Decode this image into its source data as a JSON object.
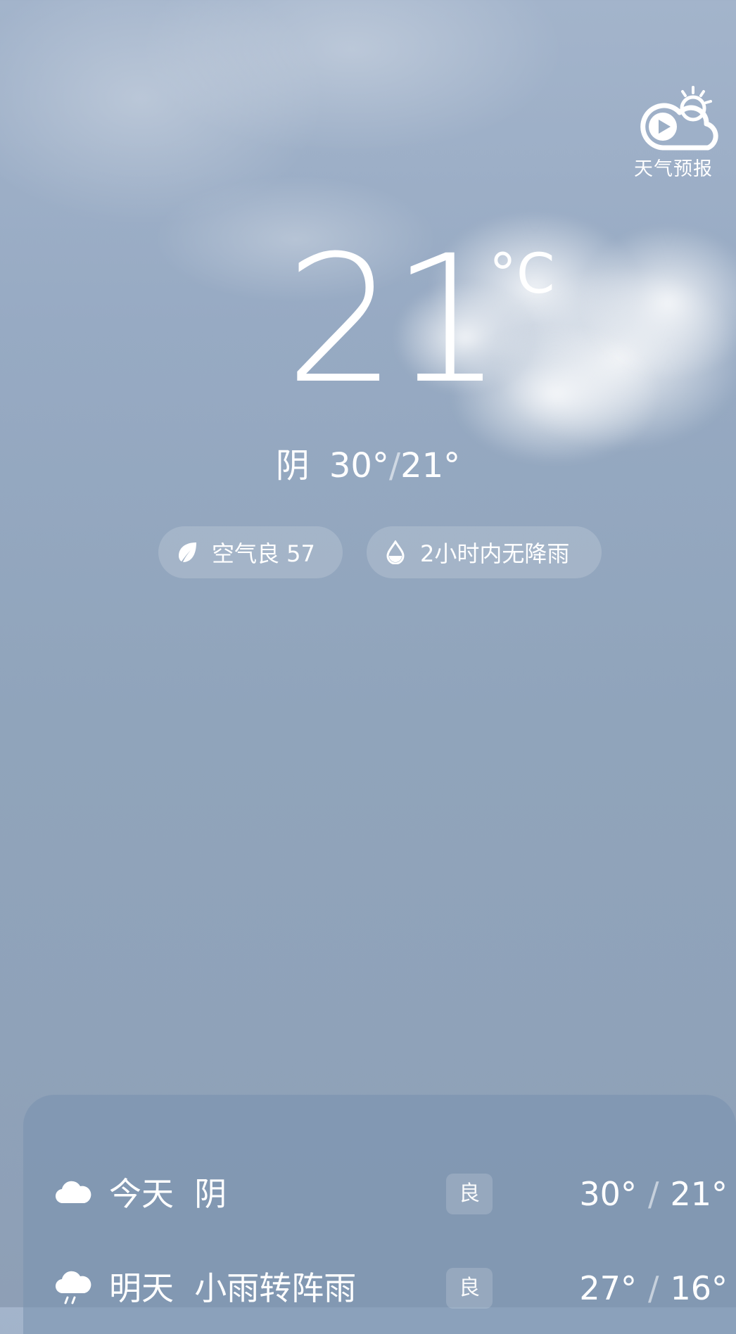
{
  "forecast_button": {
    "label": "天气预报",
    "icon": "play-cloud-sun-icon"
  },
  "current": {
    "temperature": "21",
    "unit": "°C",
    "condition": "阴",
    "high": "30°",
    "low": "21°",
    "range_separator": "/"
  },
  "pills": {
    "air_quality": {
      "text": "空气良 57",
      "icon": "leaf-icon"
    },
    "precipitation": {
      "text": "2小时内无降雨",
      "icon": "water-drop-icon"
    }
  },
  "daily": [
    {
      "day": "今天",
      "condition": "阴",
      "aqi": "良",
      "high": "30°",
      "low": "21°",
      "sep": "/",
      "icon": "cloud-icon"
    },
    {
      "day": "明天",
      "condition": "小雨转阵雨",
      "aqi": "良",
      "high": "27°",
      "low": "16°",
      "sep": "/",
      "icon": "rain-cloud-icon"
    }
  ],
  "colors": {
    "background_top": "#a3b4cb",
    "background_bottom": "#8e9fb6",
    "text": "#ffffff"
  }
}
